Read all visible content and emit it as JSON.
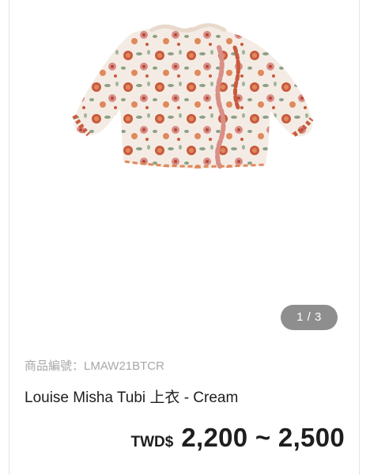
{
  "gallery": {
    "pager_text": "1 / 3",
    "product_image_alt": "floral ruffle blouse",
    "colors": {
      "fabric_base": "#f4ece4",
      "flower_primary": "#c95a3e",
      "flower_secondary": "#e0895c",
      "flower_pink": "#d98e86",
      "leaf": "#8aa087",
      "pager_bg": "#8e8e8e"
    }
  },
  "product": {
    "sku_label": "商品編號：",
    "sku_value": "LMAW21BTCR",
    "title": "Louise Misha Tubi 上衣 - Cream",
    "currency": "TWD$",
    "price_range": "2,200 ~ 2,500"
  }
}
